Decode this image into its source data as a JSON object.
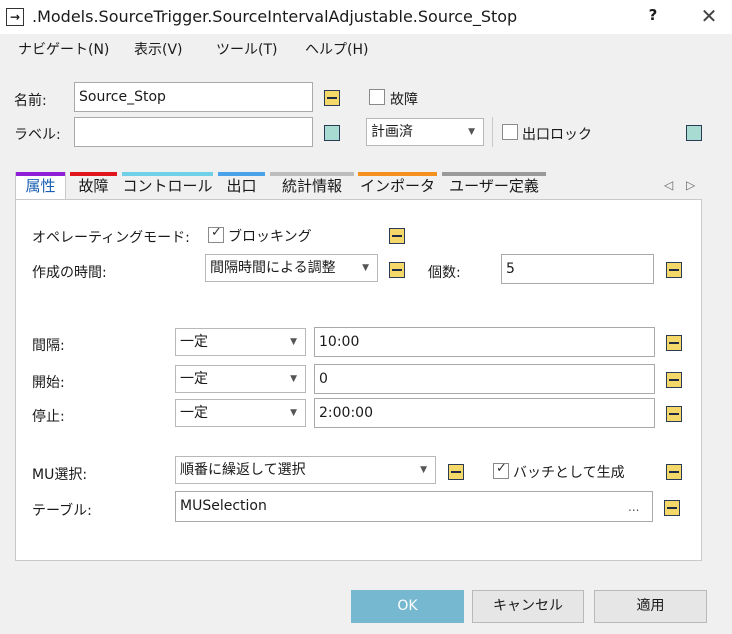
{
  "window": {
    "title": ".Models.SourceTrigger.SourceIntervalAdjustable.Source_Stop",
    "help": "?",
    "close": "✕",
    "icon_glyph": "→"
  },
  "menu": [
    "ナビゲート(N)",
    "表示(V)",
    "ツール(T)",
    "ヘルプ(H)"
  ],
  "header": {
    "name_label": "名前:",
    "name_value": "Source_Stop",
    "label_label": "ラベル:",
    "label_value": "",
    "failure_label": "故障",
    "plan_value": "計画済",
    "exit_lock_label": "出口ロック"
  },
  "tabs": [
    {
      "label": "属性",
      "color": "#8e1fd6"
    },
    {
      "label": "故障",
      "color": "#e0161c"
    },
    {
      "label": "コントロール",
      "color": "#6fd0e8"
    },
    {
      "label": "出口",
      "color": "#4aa3ea"
    },
    {
      "label": "統計情報",
      "color": "#bdbdbd"
    },
    {
      "label": "インポータ",
      "color": "#f5921f"
    },
    {
      "label": "ユーザー定義",
      "color": "#9a9a9a"
    }
  ],
  "attributes": {
    "op_mode_label": "オペレーティングモード:",
    "blocking_label": "ブロッキング",
    "blocking_checked": true,
    "creation_time_label": "作成の時間:",
    "creation_time_value": "間隔時間による調整",
    "count_label": "個数:",
    "count_value": "5",
    "interval_label": "間隔:",
    "interval_mode": "一定",
    "interval_value": "10:00",
    "start_label": "開始:",
    "start_mode": "一定",
    "start_value": "0",
    "stop_label": "停止:",
    "stop_mode": "一定",
    "stop_value": "2:00:00",
    "mu_select_label": "MU選択:",
    "mu_select_value": "順番に繰返して選択",
    "batch_label": "バッチとして生成",
    "batch_checked": true,
    "table_label": "テーブル:",
    "table_value": "MUSelection",
    "table_browse": "..."
  },
  "footer": {
    "ok": "OK",
    "cancel": "キャンセル",
    "apply": "適用"
  },
  "colors": {
    "accent_ok": "#75b8cf",
    "minus_button": "#f5d86a",
    "green_button": "#a8dcd2"
  }
}
